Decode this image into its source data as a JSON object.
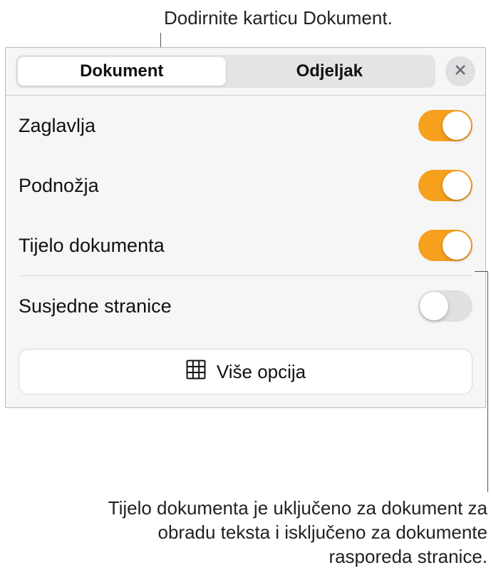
{
  "callouts": {
    "top": "Dodirnite karticu Dokument.",
    "bottom": "Tijelo dokumenta je uključeno za dokument za obradu teksta i isključeno za dokumente rasporeda stranice."
  },
  "tabs": {
    "document": "Dokument",
    "section": "Odjeljak"
  },
  "settings": {
    "headers": {
      "label": "Zaglavlja",
      "on": true
    },
    "footers": {
      "label": "Podnožja",
      "on": true
    },
    "body": {
      "label": "Tijelo dokumenta",
      "on": true
    },
    "facing": {
      "label": "Susjedne stranice",
      "on": false
    }
  },
  "more_options": "Više opcija"
}
